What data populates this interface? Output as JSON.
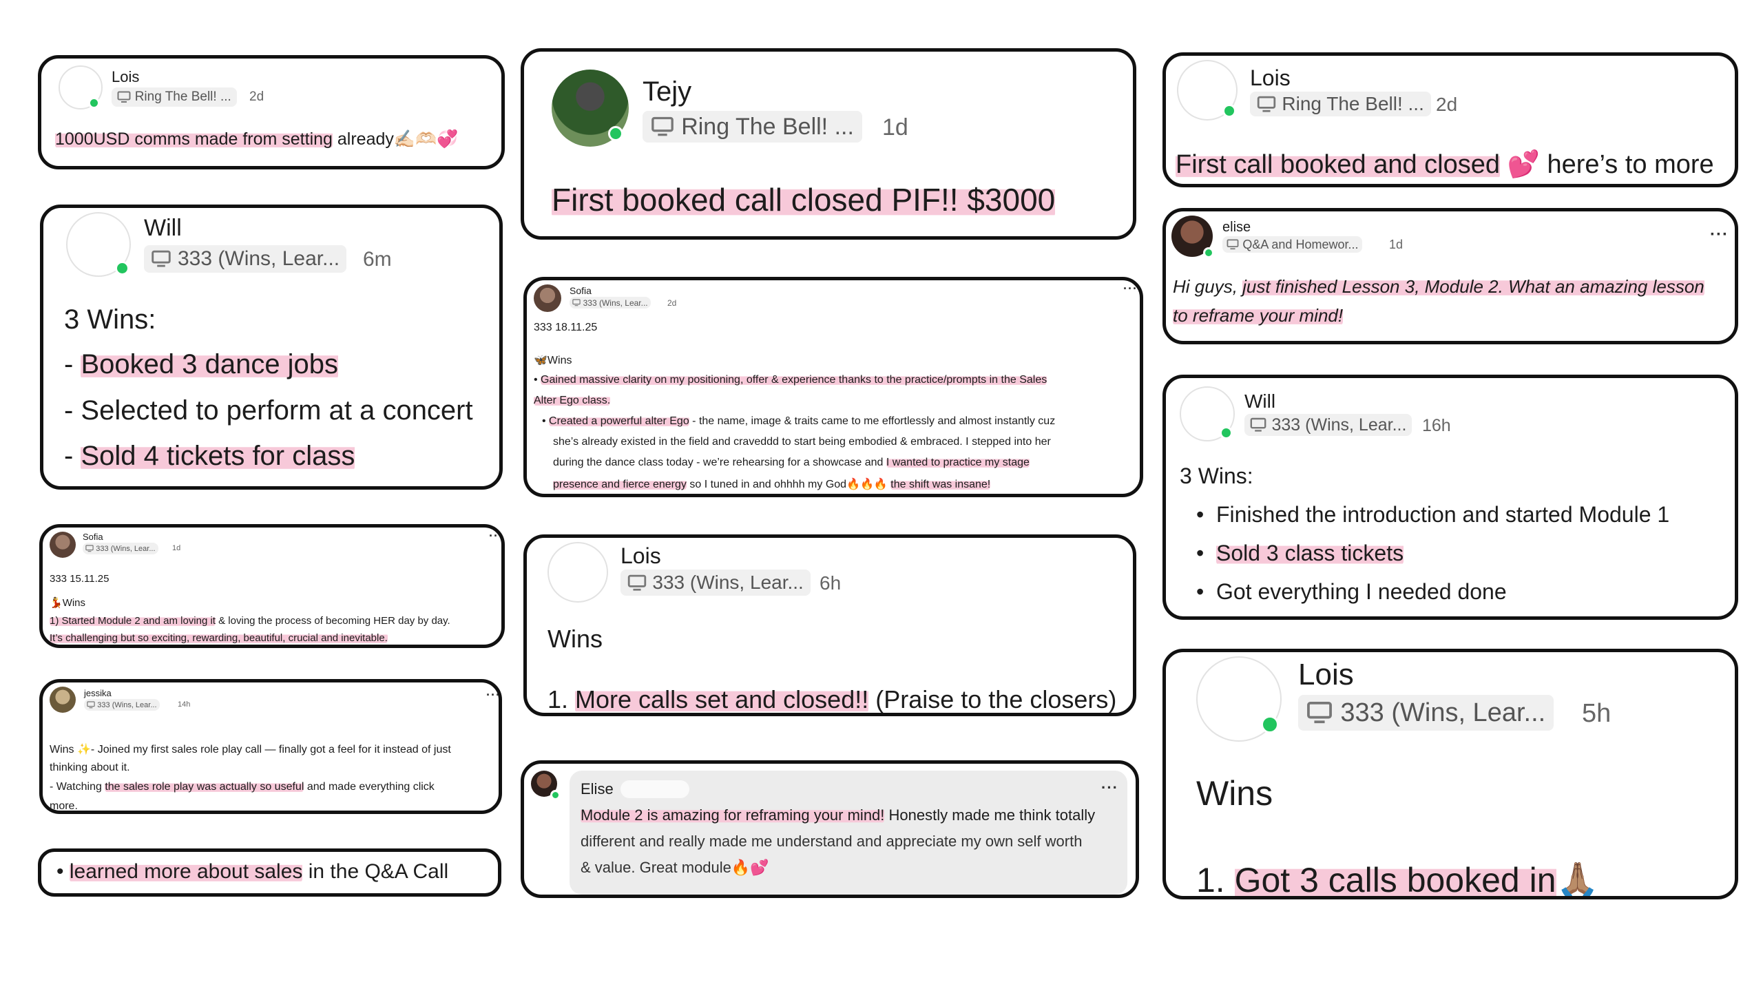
{
  "cards": {
    "c1": {
      "name": "Lois",
      "channel": "Ring The Bell! ...",
      "ago": "2d",
      "text_hl": "1000USD comms made from setting",
      "text_rest": " already",
      "emoji": "✍🏻🫶🏻💞"
    },
    "c2": {
      "name": "Will",
      "channel": "333 (Wins, Lear...",
      "ago": "6m",
      "title": "3 Wins:",
      "lines": [
        "- Booked 3 dance jobs",
        "- Selected to perform at a concert",
        "- Sold 4 tickets for class"
      ]
    },
    "c3": {
      "name": "Sofia",
      "channel": "333 (Wins, Lear...",
      "ago": "1d",
      "date": "333 15.11.25",
      "wins_label": "Wins",
      "line1_hl": "1) Started Module 2 and am loving it",
      "line1_rest": " & loving the process of becoming HER day by day.",
      "line2": "It’s challenging but so exciting, rewarding, beautiful, crucial and inevitable."
    },
    "c4": {
      "name": "jessika",
      "channel": "333 (Wins, Lear...",
      "ago": "14h",
      "line1": "Wins ✨- Joined my first sales role play call — finally got a feel for it instead of just",
      "line2": "thinking about it.",
      "line3a": "- Watching ",
      "line3_hl": "the sales role play was actually so useful",
      "line3b": " and made everything click",
      "line4": "more."
    },
    "c5": {
      "bullet": "•",
      "text_hl": "learned more about sales",
      "text_rest": " in the Q&A Call"
    },
    "c6": {
      "name": "Tejy",
      "channel": "Ring The Bell! ...",
      "ago": "1d",
      "text": "First booked call closed PIF!! $3000"
    },
    "c7": {
      "name": "Sofia",
      "channel": "333 (Wins, Lear...",
      "ago": "2d",
      "date": "333 18.11.25",
      "wins_label": "Wins",
      "l1a": "• ",
      "l1_hl": "Gained massive clarity on my positioning, offer & experience thanks to the practice/prompts in the Sales",
      "l2_hl": "Alter Ego class.",
      "l3a": "• ",
      "l3_hl": "Created a powerful alter Ego",
      "l3b": " - the name, image & traits came to me effortlessly and almost instantly cuz",
      "l4": "she’s already existed in the field and craveddd to start being embodied & embraced. I stepped into her",
      "l5a": "during the dance class today - we’re rehearsing for a showcase and ",
      "l5_hl": "I wanted to practice my stage",
      "l6_hl": "presence and fierce energy",
      "l6b": " so I tuned in and ohhhh my God🔥🔥🔥 ",
      "l6_hl2": "the shift was insane!"
    },
    "c8": {
      "name": "Lois",
      "channel": "333 (Wins, Lear...",
      "ago": "6h",
      "title": "Wins",
      "line_num": "1. ",
      "line_hl": "More calls set and closed!!",
      "line_rest": " (Praise to the closers)"
    },
    "c9": {
      "name": "Elise",
      "l1_hl": "Module 2 is amazing for reframing your mind!",
      "l1b": " Honestly made me think totally",
      "l2": "different and really made me understand and appreciate my own self worth",
      "l3": "& value. Great module🔥💕"
    },
    "c10": {
      "name": "Lois",
      "channel": "Ring The Bell! ...",
      "ago": "2d",
      "text_hl": "First call booked and closed",
      "emoji": " 💕",
      "text_rest": " here’s to more"
    },
    "c11": {
      "name": "elise",
      "channel": "Q&A and Homewor...",
      "ago": "1d",
      "l1a": "Hi guys, ",
      "l1_hl": "just finished Lesson 3, Module 2. What an amazing lesson",
      "l2_hl": "to reframe your mind!"
    },
    "c12": {
      "name": "Will",
      "channel": "333 (Wins, Lear...",
      "ago": "16h",
      "title": "3 Wins:",
      "b1": "Finished the introduction and started Module 1",
      "b2": "Sold 3 class tickets",
      "b3": "Got everything I needed done"
    },
    "c13": {
      "name": "Lois",
      "channel": "333 (Wins, Lear...",
      "ago": "5h",
      "title": "Wins",
      "line_num": "1. ",
      "line_hl": "Got 3 calls booked in",
      "emoji": "🙏🏽"
    }
  },
  "icons": {
    "channel": "monitor-icon",
    "more": "more-options-icon",
    "online": "online-status-icon"
  },
  "colors": {
    "highlight": "#f7c9d9",
    "online": "#22c55e",
    "border": "#111111",
    "chip": "#f0f0f0"
  }
}
